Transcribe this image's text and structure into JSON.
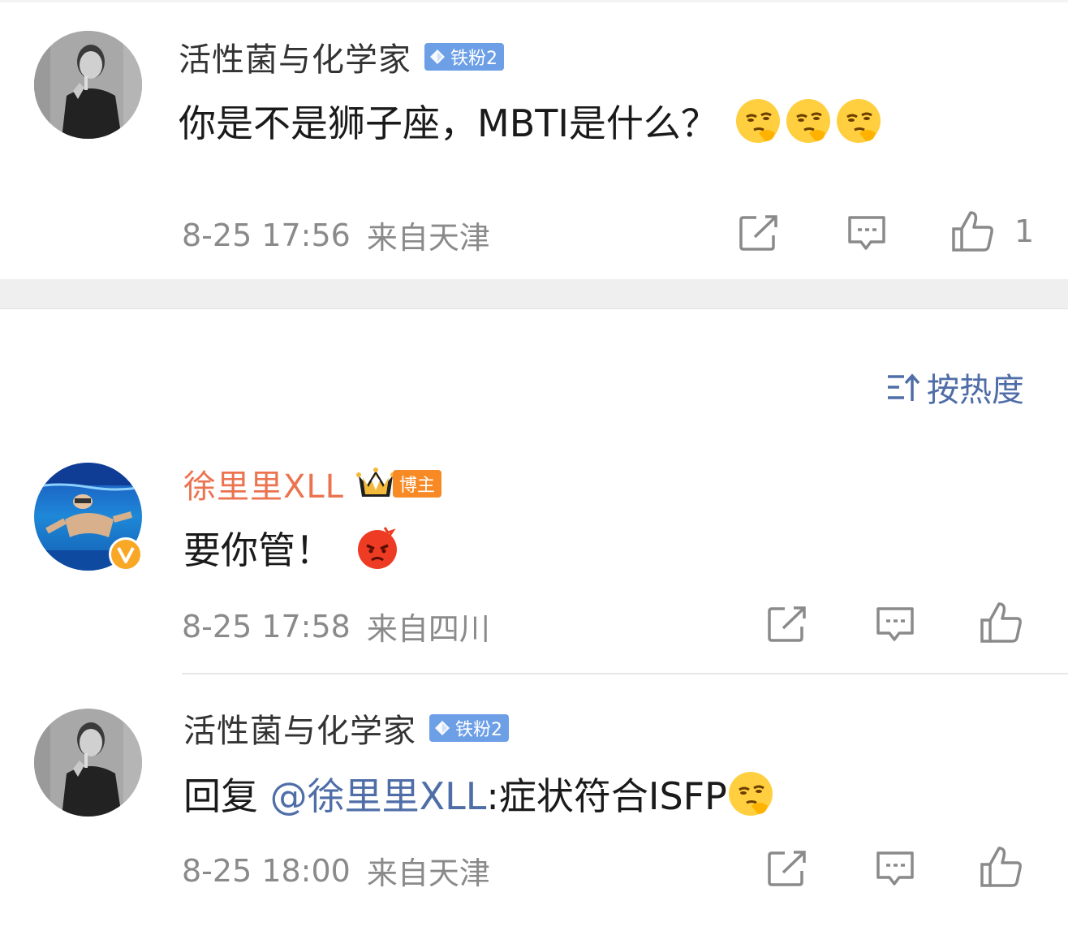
{
  "comments": [
    {
      "username": "活性菌与化学家",
      "fan_badge": "铁粉2",
      "text": "你是不是狮子座，MBTI是什么？",
      "emojis": [
        "thinking-face",
        "thinking-face",
        "thinking-face"
      ],
      "time": "8-25 17:56",
      "location": "来自天津",
      "like_count": "1"
    },
    {
      "username": "徐里里XLL",
      "blogger_badge": "博主",
      "text": "要你管！",
      "emojis": [
        "angry-face"
      ],
      "time": "8-25 17:58",
      "location": "来自四川",
      "like_count": ""
    },
    {
      "username": "活性菌与化学家",
      "fan_badge": "铁粉2",
      "reply_prefix": "回复 ",
      "mention": "@徐里里XLL",
      "text": ":症状符合ISFP",
      "emojis": [
        "thinking-face"
      ],
      "time": "8-25 18:00",
      "location": "来自天津",
      "like_count": ""
    }
  ],
  "sort": {
    "label": "按热度",
    "icon": "sort-icon"
  },
  "colors": {
    "blogger_name": "#eb7350",
    "mention": "#4f6ea8",
    "fan_badge": "#6d9fe6",
    "meta": "#8a8a8a"
  }
}
